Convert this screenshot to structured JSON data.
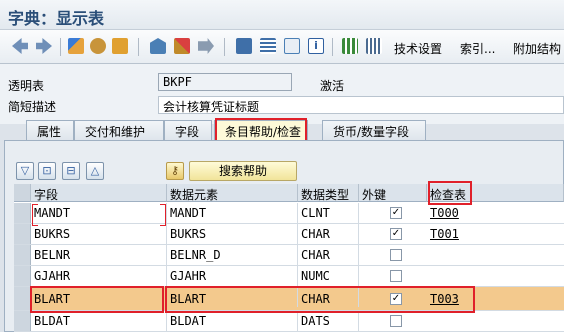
{
  "window": {
    "title": "字典：显示表"
  },
  "toolbar": {
    "tech_settings_label": "技术设置",
    "index_label": "索引...",
    "append_label": "附加结构"
  },
  "form": {
    "table_label": "透明表",
    "table_value": "BKPF",
    "status_label": "激活",
    "desc_label": "简短描述",
    "desc_value": "会计核算凭证标题"
  },
  "tabs": [
    {
      "label": "属性"
    },
    {
      "label": "交付和维护"
    },
    {
      "label": "字段"
    },
    {
      "label": "条目帮助/检查"
    },
    {
      "label": "货币/数量字段"
    }
  ],
  "search_help_button": "搜索帮助",
  "grid": {
    "headers": [
      "字段",
      "数据元素",
      "数据类型",
      "外键",
      "检查表"
    ],
    "rows": [
      {
        "field": "MANDT",
        "element": "MANDT",
        "type": "CLNT",
        "fk": "✓",
        "check": "T000"
      },
      {
        "field": "BUKRS",
        "element": "BUKRS",
        "type": "CHAR",
        "fk": "✓",
        "check": "T001"
      },
      {
        "field": "BELNR",
        "element": "BELNR_D",
        "type": "CHAR",
        "fk": "",
        "check": ""
      },
      {
        "field": "GJAHR",
        "element": "GJAHR",
        "type": "NUMC",
        "fk": "",
        "check": ""
      },
      {
        "field": "BLART",
        "element": "BLART",
        "type": "CHAR",
        "fk": "✓",
        "check": "T003"
      },
      {
        "field": "BLDAT",
        "element": "BLDAT",
        "type": "DATS",
        "fk": "",
        "check": ""
      }
    ]
  },
  "colors": {
    "accent": "#e0202a",
    "selected_row": "#f3c98d",
    "title": "#2a4e78"
  }
}
